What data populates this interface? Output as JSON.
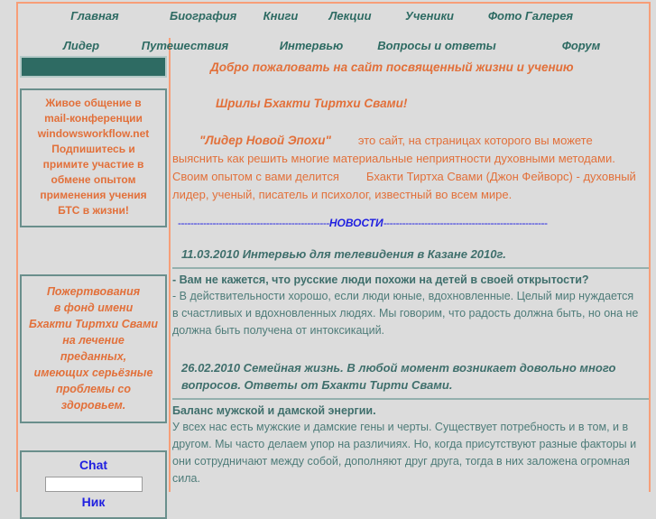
{
  "colors": {
    "frame": "#f79e78",
    "accent_orange": "#e2703a",
    "teal": "#2e6b63",
    "news_teal": "#3f6f6c",
    "blue": "#2020e0",
    "page_bg": "#dcdcdc"
  },
  "nav": {
    "row1": [
      {
        "label": "Главная"
      },
      {
        "label": "Биография"
      },
      {
        "label": "Книги"
      },
      {
        "label": "Лекции"
      },
      {
        "label": "Ученики"
      },
      {
        "label": "Фото Галерея"
      }
    ],
    "row2": [
      {
        "label": "Лидер"
      },
      {
        "label": "Путешествия"
      },
      {
        "label": "Интервью"
      },
      {
        "label": "Вопросы и ответы"
      },
      {
        "label": "Форум"
      }
    ]
  },
  "sidebar": {
    "mail_box": {
      "lines": [
        "Живое общение в",
        "mail-конференции",
        "windowsworkflow.net",
        "Подпишитесь и",
        "примите участие в",
        "обмене опытом",
        "применения учения",
        "БТС в жизни!"
      ]
    },
    "donate_box": {
      "lines": [
        "Пожертвования",
        "в фонд имени",
        "Бхакти Тиртхи Свами",
        "на лечение",
        "преданных,",
        "имеющих серьёзные",
        "проблемы со",
        "здоровьем."
      ]
    },
    "chat": {
      "title": "Chat",
      "input_value": "",
      "input_placeholder": "",
      "nick_label": "Ник"
    }
  },
  "main": {
    "welcome_line1": "Добро пожаловать на сайт посвященный жизни и учению",
    "welcome_line2": "Шрилы Бхакти Тиртхи Свами!",
    "intro": {
      "quote": "\"Лидер Новой Эпохи\"",
      "text_after_quote": "это сайт, на страницах которого вы можете выяснить как решить многие материальные неприятности духовными методами.",
      "paragraph2_part1": "Своим опытом с вами делится",
      "paragraph2_name": "Бхакти Тиртха Свами  (Джон Фейворс)  -",
      "paragraph2_part2": "духовный лидер, ученый, писатель и психолог, известный во всем мире."
    },
    "news_label": "НОВОСТИ",
    "news_rule_left": "------------------------------------------------",
    "news_rule_right": "----------------------------------------------------",
    "news": [
      {
        "heading": "11.03.2010 Интервью для телевидения в Казане 2010г.",
        "question": "- Вам не кажется, что русские люди похожи на детей в своей открытости?",
        "answer": "- В действительности хорошо, если люди юные, вдохновленные. Целый мир нуждается в счастливых и вдохновленных людях. Мы говорим, что радость должна быть, но она не должна быть получена от интоксикаций."
      },
      {
        "heading": "26.02.2010 Семейная жизнь. В любой момент возникает довольно много вопросов. Ответы от Бхакти Тирти Свами.",
        "question": "Баланс мужской и дамской энергии.",
        "answer": "У всех нас есть мужские и дамские гены и черты. Существует потребность и в том, и в другом. Мы часто делаем упор на различиях. Но, когда присутствуют разные факторы и они сотрудничают между собой, дополняют друг друга, тогда в них заложена огромная сила."
      }
    ]
  }
}
